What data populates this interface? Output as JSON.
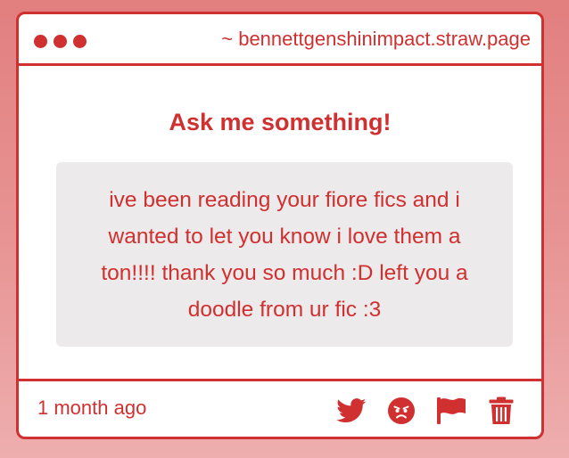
{
  "window": {
    "url": "~ bennettgenshinimpact.straw.page"
  },
  "main": {
    "heading": "Ask me something!",
    "question": "ive been reading your fiore fics and i wanted to let you know i love them a ton!!!! thank you so much :D left you a doodle from ur fic :3"
  },
  "footer": {
    "timestamp": "1 month ago",
    "actions": [
      {
        "icon": "twitter-icon"
      },
      {
        "icon": "angry-face-icon"
      },
      {
        "icon": "flag-icon"
      },
      {
        "icon": "trash-icon"
      }
    ]
  },
  "colors": {
    "accent": "#d0302f",
    "question_background": "#eceaea",
    "page_background": "#e89595"
  }
}
